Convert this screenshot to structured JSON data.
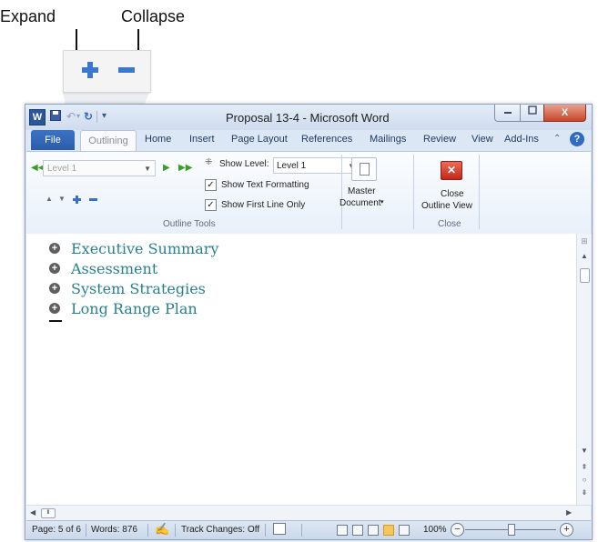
{
  "callouts": {
    "expand_label": "Expand",
    "collapse_label": "Collapse"
  },
  "window": {
    "title": "Proposal 13-4 - Microsoft Word",
    "app_icon": "W",
    "close_glyph": "X"
  },
  "tabs": {
    "file": "File",
    "active": "Outlining",
    "items": [
      "Home",
      "Insert",
      "Page Layout",
      "References",
      "Mailings",
      "Review",
      "View",
      "Add-Ins"
    ]
  },
  "ribbon": {
    "outline_tools": {
      "level_value": "Level 1",
      "show_level_label": "Show Level:",
      "show_level_value": "Level 1",
      "show_text_formatting": "Show Text Formatting",
      "show_text_formatting_checked": true,
      "show_first_line_only": "Show First Line Only",
      "show_first_line_only_checked": true,
      "group_label": "Outline Tools"
    },
    "master_document": {
      "line1": "Master",
      "line2": "Document"
    },
    "close_group": {
      "line1": "Close",
      "line2": "Outline View",
      "group_label": "Close"
    }
  },
  "document": {
    "headings": [
      "Executive Summary",
      "Assessment",
      "System Strategies",
      "Long Range Plan"
    ]
  },
  "status_bar": {
    "page": "Page: 5 of 6",
    "words": "Words: 876",
    "track_changes": "Track Changes: Off",
    "zoom": "100%"
  },
  "colors": {
    "heading_text": "#27808f",
    "file_tab": "#2a5caa",
    "window_close": "#c7452a"
  }
}
